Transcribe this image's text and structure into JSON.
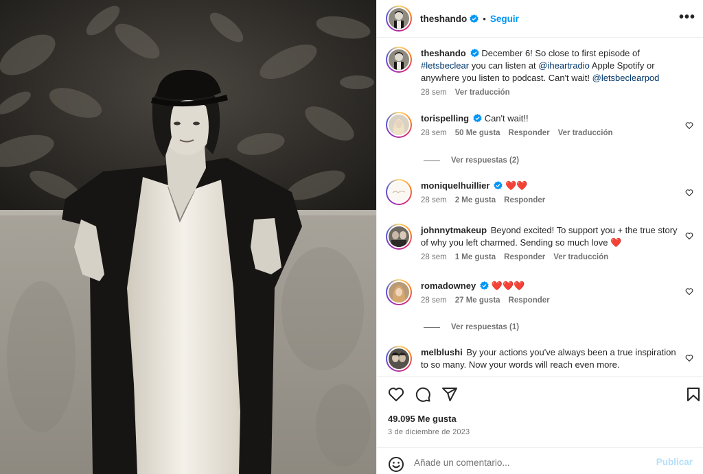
{
  "post": {
    "author": "theshando",
    "follow_label": "Seguir",
    "separator": "•",
    "more_label": "•••",
    "caption": {
      "username": "theshando",
      "text_1": "December 6! So close to first episode of",
      "hashtag": "#letsbeclear",
      "text_2": " you can listen at ",
      "mention_1": "@iheartradio",
      "text_3": " Apple Spotify or anywhere you listen to podcast. Can't wait! ",
      "mention_2": "@letsbeclearpod",
      "time": "28 sem",
      "translate": "Ver traducción"
    },
    "likes": "49.095 Me gusta",
    "date": "3 de diciembre de 2023",
    "comment_placeholder": "Añade un comentario...",
    "publish_label": "Publicar"
  },
  "comments": [
    {
      "username": "torispelling",
      "verified": true,
      "text": "Can't wait!!",
      "time": "28 sem",
      "likes": "50 Me gusta",
      "reply": "Responder",
      "translate": "Ver traducción",
      "view_replies": "Ver respuestas (2)"
    },
    {
      "username": "moniquelhuillier",
      "verified": true,
      "text": "❤️❤️",
      "time": "28 sem",
      "likes": "2 Me gusta",
      "reply": "Responder"
    },
    {
      "username": "johnnytmakeup",
      "verified": false,
      "text": "Beyond excited! To support you + the true story of why you left charmed. Sending so much love ❤️",
      "time": "28 sem",
      "likes": "1 Me gusta",
      "reply": "Responder",
      "translate": "Ver traducción"
    },
    {
      "username": "romadowney",
      "verified": true,
      "text": "❤️❤️❤️",
      "time": "28 sem",
      "likes": "27 Me gusta",
      "reply": "Responder",
      "view_replies": "Ver respuestas (1)"
    },
    {
      "username": "melblushi",
      "verified": false,
      "text": "By your actions you've always been a true inspiration to so many. Now your words will reach even more."
    }
  ],
  "colors": {
    "accent": "#0095f6",
    "text": "#262626",
    "secondary": "#737373",
    "link": "#00376b",
    "publish_disabled": "#b2dffc"
  }
}
